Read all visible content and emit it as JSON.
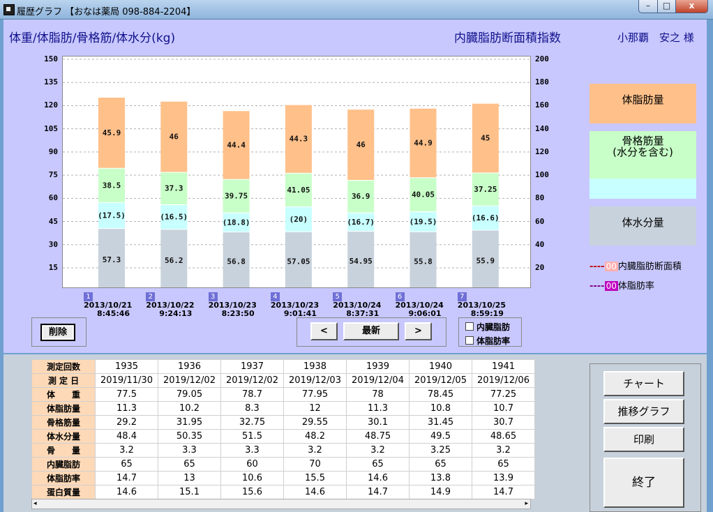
{
  "window": {
    "title": "履歴グラフ 【おなは薬局 098-884-2204】",
    "controls": {
      "min": "–",
      "max": "□",
      "close": "x"
    }
  },
  "header": {
    "left_title": "体重/体脂肪/骨格筋/体水分(kg)",
    "center_title": "内臓脂肪断面積指数",
    "patient": "小那覇　安之 様"
  },
  "chart_data": {
    "type": "bar",
    "stacked": true,
    "left_axis": {
      "ticks": [
        15,
        30,
        45,
        60,
        75,
        90,
        105,
        120,
        135,
        150
      ],
      "ylim": [
        0,
        150
      ]
    },
    "right_axis": {
      "ticks": [
        20,
        40,
        60,
        80,
        100,
        120,
        140,
        160,
        180,
        200
      ],
      "ylim": [
        0,
        200
      ]
    },
    "grid": true,
    "categories": [
      {
        "index": "1",
        "date": "2013/10/21",
        "time": "8:45:46"
      },
      {
        "index": "2",
        "date": "2013/10/22",
        "time": "9:24:13"
      },
      {
        "index": "3",
        "date": "2013/10/23",
        "time": "8:23:50"
      },
      {
        "index": "4",
        "date": "2013/10/23",
        "time": "9:01:41"
      },
      {
        "index": "5",
        "date": "2013/10/24",
        "time": "8:37:31"
      },
      {
        "index": "6",
        "date": "2013/10/24",
        "time": "9:06:01"
      },
      {
        "index": "7",
        "date": "2013/10/25",
        "time": "8:59:19"
      }
    ],
    "series": [
      {
        "name": "体水分量",
        "color": "#c8d2dc",
        "values": [
          40.7,
          40.1,
          38.4,
          38.6,
          38.9,
          38.6,
          39.6
        ],
        "labels": [
          "57.3",
          "56.2",
          "56.8",
          "57.05",
          "54.95",
          "55.8",
          "55.9"
        ]
      },
      {
        "name": "体水分",
        "color": "#c8ffff",
        "values": [
          16.8,
          16.0,
          12.5,
          16.2,
          12.0,
          13.0,
          15.8
        ],
        "labels": [
          "(17.5)",
          "(16.5)",
          "(18.8)",
          "(20)",
          "(16.7)",
          "(19.5)",
          "(16.6)"
        ]
      },
      {
        "name": "骨格筋量",
        "color": "#c8ffc8",
        "values": [
          22.2,
          21.0,
          21.6,
          21.7,
          21.0,
          22.0,
          21.3
        ],
        "labels": [
          "38.5",
          "37.3",
          "39.75",
          "41.05",
          "36.9",
          "40.05",
          "37.25"
        ]
      },
      {
        "name": "体脂肪量",
        "color": "#ffc08a",
        "values": [
          45.9,
          46.0,
          44.4,
          44.3,
          46.0,
          44.9,
          45.0
        ],
        "labels": [
          "45.9",
          "46",
          "44.4",
          "44.3",
          "46",
          "44.9",
          "45"
        ]
      }
    ]
  },
  "legend": {
    "fat": "体脂肪量",
    "muscle_l1": "骨格筋量",
    "muscle_l2": "(水分を含む)",
    "water": "体水分量",
    "visceral_dash": "----",
    "visceral_value": "00",
    "visceral_label": "内臓脂肪断面積",
    "bodyfat_dash": "----",
    "bodyfat_value": "00",
    "bodyfat_label": "体脂肪率",
    "colors": {
      "fat": "#ffc08a",
      "muscle": "#c8ffc8",
      "water_top": "#c8ffff",
      "water": "#c8d2dc"
    }
  },
  "controls": {
    "delete_label": "削除",
    "prev_label": "<",
    "latest_label": "最新",
    "next_label": ">",
    "chk_visceral": "内臓脂肪",
    "chk_bodyfat": "体脂肪率"
  },
  "table": {
    "rows": [
      {
        "label": "測定回数",
        "values": [
          "1935",
          "1936",
          "1937",
          "1938",
          "1939",
          "1940",
          "1941"
        ]
      },
      {
        "label": "測 定 日",
        "values": [
          "2019/11/30",
          "2019/12/02",
          "2019/12/02",
          "2019/12/03",
          "2019/12/04",
          "2019/12/05",
          "2019/12/06"
        ]
      },
      {
        "label": "体　　重",
        "values": [
          "77.5",
          "79.05",
          "78.7",
          "77.95",
          "78",
          "78.45",
          "77.25"
        ]
      },
      {
        "label": "体脂肪量",
        "values": [
          "11.3",
          "10.2",
          "8.3",
          "12",
          "11.3",
          "10.8",
          "10.7"
        ]
      },
      {
        "label": "骨格筋量",
        "values": [
          "29.2",
          "31.95",
          "32.75",
          "29.55",
          "30.1",
          "31.45",
          "30.7"
        ]
      },
      {
        "label": "体水分量",
        "values": [
          "48.4",
          "50.35",
          "51.5",
          "48.2",
          "48.75",
          "49.5",
          "48.65"
        ]
      },
      {
        "label": "骨　　量",
        "values": [
          "3.2",
          "3.3",
          "3.3",
          "3.2",
          "3.2",
          "3.25",
          "3.2"
        ]
      },
      {
        "label": "内臓脂肪",
        "values": [
          "65",
          "65",
          "60",
          "70",
          "65",
          "65",
          "65"
        ]
      },
      {
        "label": "体脂肪率",
        "values": [
          "14.7",
          "13",
          "10.6",
          "15.5",
          "14.6",
          "13.8",
          "13.9"
        ]
      },
      {
        "label": "蛋白質量",
        "values": [
          "14.6",
          "15.1",
          "15.6",
          "14.6",
          "14.7",
          "14.9",
          "14.7"
        ]
      }
    ]
  },
  "side_buttons": {
    "chart": "チャート",
    "trend": "推移グラフ",
    "print": "印刷",
    "exit": "終了"
  },
  "scroll": {
    "left": "◂",
    "right": "▸"
  }
}
